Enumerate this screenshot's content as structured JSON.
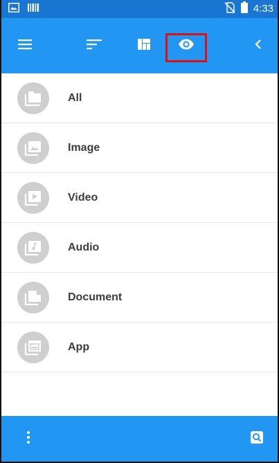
{
  "status_bar": {
    "time": "4:33",
    "icons": [
      "image-notification-icon",
      "barcode-notification-icon",
      "no-sim-icon",
      "battery-icon"
    ]
  },
  "toolbar": {
    "buttons": [
      "menu-icon",
      "sort-icon",
      "view-mode-icon",
      "visibility-icon",
      "back-chevron-icon"
    ],
    "highlighted": "visibility-icon"
  },
  "categories": [
    {
      "label": "All",
      "icon": "folder-icon"
    },
    {
      "label": "Image",
      "icon": "image-icon"
    },
    {
      "label": "Video",
      "icon": "video-icon"
    },
    {
      "label": "Audio",
      "icon": "audio-icon"
    },
    {
      "label": "Document",
      "icon": "document-icon"
    },
    {
      "label": "App",
      "icon": "app-icon"
    }
  ],
  "bottom_bar": {
    "buttons": [
      "more-vert-icon",
      "search-icon"
    ]
  },
  "colors": {
    "status_bar": "#1976d2",
    "toolbar": "#2196f3",
    "highlight": "#e01010",
    "icon_circle": "#cfcfcf"
  }
}
